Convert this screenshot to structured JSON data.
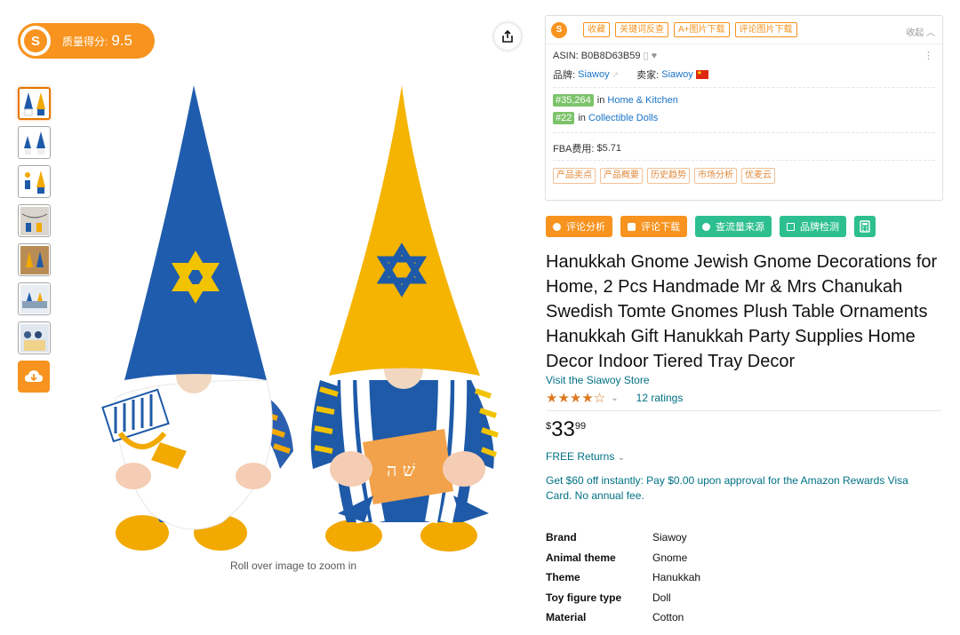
{
  "quality": {
    "label": "质量得分:",
    "score": "9.5"
  },
  "gallery": {
    "thumbnail_count": 7,
    "zoom_hint": "Roll over image to zoom in"
  },
  "plugin": {
    "tags": [
      "收藏",
      "关键词反查",
      "A+图片下载",
      "评论图片下载"
    ],
    "collapse": "收起",
    "asin_label": "ASIN:",
    "asin": "B0B8D63B59",
    "brand_label": "品牌:",
    "brand": "Siawoy",
    "seller_label": "卖家:",
    "seller": "Siawoy",
    "ranks": [
      {
        "rank": "#35,264",
        "in": "in",
        "category": "Home & Kitchen"
      },
      {
        "rank": "#22",
        "in": "in",
        "category": "Collectible Dolls"
      }
    ],
    "fba_label": "FBA费用:",
    "fba": "$5.71",
    "bottom_tabs": [
      "产品卖点",
      "产品概要",
      "历史趋势",
      "市场分析",
      "优麦云"
    ]
  },
  "actions": [
    "评论分析",
    "评论下载",
    "查流量来源",
    "品牌检测"
  ],
  "product": {
    "title": "Hanukkah Gnome Jewish Gnome Decorations for Home, 2 Pcs Handmade Mr & Mrs Chanukah Swedish Tomte Gnomes Plush Table Ornaments Hanukkah Gift Hanukkah Party Supplies Home Decor Indoor Tiered Tray Decor",
    "store": "Visit the Siawoy Store",
    "stars": "★★★★☆",
    "rating_value": 3.5,
    "ratings": "12 ratings",
    "price_symbol": "$",
    "price_whole": "33",
    "price_fraction": "99",
    "returns": "FREE Returns",
    "visa_offer": "Get $60 off instantly: Pay $0.00 upon approval for the Amazon Rewards Visa Card. No annual fee.",
    "specs": [
      {
        "key": "Brand",
        "value": "Siawoy"
      },
      {
        "key": "Animal theme",
        "value": "Gnome"
      },
      {
        "key": "Theme",
        "value": "Hanukkah"
      },
      {
        "key": "Toy figure type",
        "value": "Doll"
      },
      {
        "key": "Material",
        "value": "Cotton"
      }
    ]
  },
  "colors": {
    "accent": "#f7931e",
    "link": "#007185",
    "green": "#2dbf8f",
    "star": "#de7921"
  }
}
